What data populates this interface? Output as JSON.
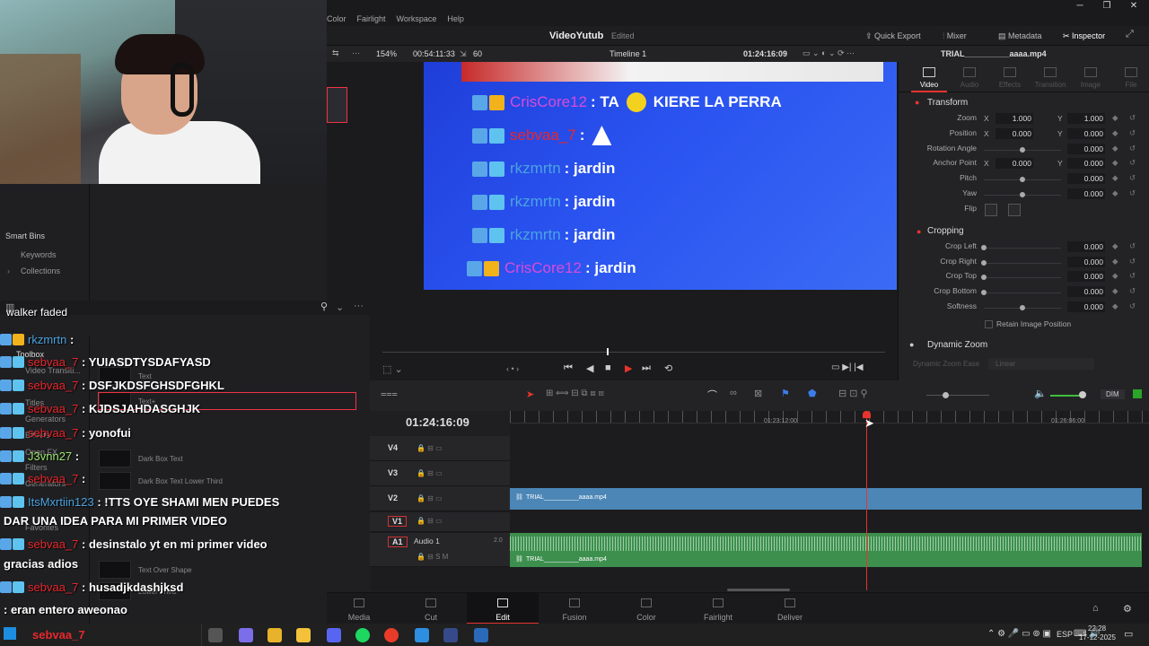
{
  "menu": [
    "Color",
    "Fairlight",
    "Workspace",
    "Help"
  ],
  "project": {
    "name": "VideoYutub",
    "status": "Edited",
    "quick_export": "Quick Export",
    "mixer": "Mixer",
    "metadata": "Metadata",
    "inspector": "Inspector"
  },
  "viewer": {
    "zoom": "154%",
    "duration": "00:54:11:33",
    "fps": "60",
    "timeline": "Timeline 1",
    "timecode": "01:24:16:09",
    "clip": "TRIAL__________aaaa.mp4"
  },
  "left": {
    "smart_bins": "Smart Bins",
    "keywords": "Keywords",
    "collections": "Collections"
  },
  "video_rows": [
    {
      "name": "CrisCore12",
      "msg": ": TA",
      "msg2": "KIERE LA PERRA",
      "color": "#d84bd8"
    },
    {
      "name": "sebvaa_7",
      "msg": ":",
      "color": "#e8272c"
    },
    {
      "name": "rkzmrtn",
      "msg": ": jardin",
      "color": "#4aa3e0"
    },
    {
      "name": "rkzmrtn",
      "msg": ": jardin",
      "color": "#4aa3e0"
    },
    {
      "name": "rkzmrtn",
      "msg": ": jardin",
      "color": "#4aa3e0"
    },
    {
      "name": "CrisCore12",
      "msg": ": jardin",
      "color": "#d84bd8"
    }
  ],
  "inspector": {
    "tabs": [
      "Video",
      "Audio",
      "Effects",
      "Transition",
      "Image",
      "File"
    ],
    "transform": "Transform",
    "zoom": {
      "label": "Zoom",
      "x": "1.000",
      "y": "1.000"
    },
    "position": {
      "label": "Position",
      "x": "0.000",
      "y": "0.000"
    },
    "rotation": {
      "label": "Rotation Angle",
      "v": "0.000"
    },
    "anchor": {
      "label": "Anchor Point",
      "x": "0.000",
      "y": "0.000"
    },
    "pitch": {
      "label": "Pitch",
      "v": "0.000"
    },
    "yaw": {
      "label": "Yaw",
      "v": "0.000"
    },
    "flip": "Flip",
    "cropping": "Cropping",
    "crop_left": {
      "label": "Crop Left",
      "v": "0.000"
    },
    "crop_right": {
      "label": "Crop Right",
      "v": "0.000"
    },
    "crop_top": {
      "label": "Crop Top",
      "v": "0.000"
    },
    "crop_bottom": {
      "label": "Crop Bottom",
      "v": "0.000"
    },
    "softness": {
      "label": "Softness",
      "v": "0.000"
    },
    "retain": "Retain Image Position",
    "dynamic_zoom": "Dynamic Zoom",
    "dz_ease": "Dynamic Zoom Ease",
    "dz_linear": "Linear"
  },
  "chat": [
    {
      "name": "walker faded",
      "msg": "",
      "color": "#fff"
    },
    {
      "name": "rkzmrtn",
      "msg": ":",
      "color": "#4aa3e0"
    },
    {
      "name": "sebvaa_7",
      "msg": ": YUIASDTYSDAFYASD",
      "color": "#e8272c"
    },
    {
      "name": "sebvaa_7",
      "msg": ": DSFJKDSFGHSDFGHKL",
      "color": "#e8272c"
    },
    {
      "name": "sebvaa_7",
      "msg": ": KJDSJAHDASGHJK",
      "color": "#e8272c"
    },
    {
      "name": "sebvaa_7",
      "msg": ": yonofui",
      "color": "#e8272c"
    },
    {
      "name": "J3vnn27",
      "msg": ":",
      "color": "#9ae86a"
    },
    {
      "name": "sebvaa_7",
      "msg": ":",
      "color": "#e8272c"
    },
    {
      "name": "ItsMxrtiin123",
      "msg": ": !TTS OYE SHAMI MEN PUEDES",
      "color": "#4aa3e0"
    },
    {
      "name": "",
      "msg": "DAR UNA IDEA PARA MI PRIMER VIDEO",
      "color": "#fff"
    },
    {
      "name": "sebvaa_7",
      "msg": ": desinstalo yt en mi primer video",
      "color": "#e8272c"
    },
    {
      "name": "",
      "msg": "gracias adios",
      "color": "#fff"
    },
    {
      "name": "sebvaa_7",
      "msg": ": husadjkdashjksd",
      "color": "#e8272c"
    },
    {
      "name": "",
      "msg": ": eran entero aweonao",
      "color": "#fff"
    }
  ],
  "toolbox": {
    "title": "Toolbox",
    "items": [
      "Video Transiti...",
      "Titles",
      "Generators",
      "Effects",
      "Open FX",
      "Filters",
      "Generators",
      "Favorites"
    ],
    "titles_list": [
      "Text",
      "Text+",
      "Dark Box Text",
      "Dark Box Text Lower Third",
      "Text Over Shape",
      "Lower Third"
    ]
  },
  "timeline": {
    "timecode": "01:24:16:09",
    "ruler": [
      "01:23:12:00",
      "01:26:06:00"
    ],
    "tracks": [
      "V4",
      "V3",
      "V2",
      "V1",
      "A1"
    ],
    "audio_name": "Audio 1",
    "audio_ch": "2.0",
    "clip_v2": "TRIAL__________aaaa.mp4",
    "clip_a1": "TRIAL__________aaaa.mp4",
    "dim": "DIM"
  },
  "pages": [
    "Media",
    "Cut",
    "Edit",
    "Fusion",
    "Color",
    "Fairlight",
    "Deliver"
  ],
  "taskbar": {
    "user": "sebvaa_7",
    "time": "22:28",
    "date": "17-12-2025",
    "lang": "ESP"
  }
}
